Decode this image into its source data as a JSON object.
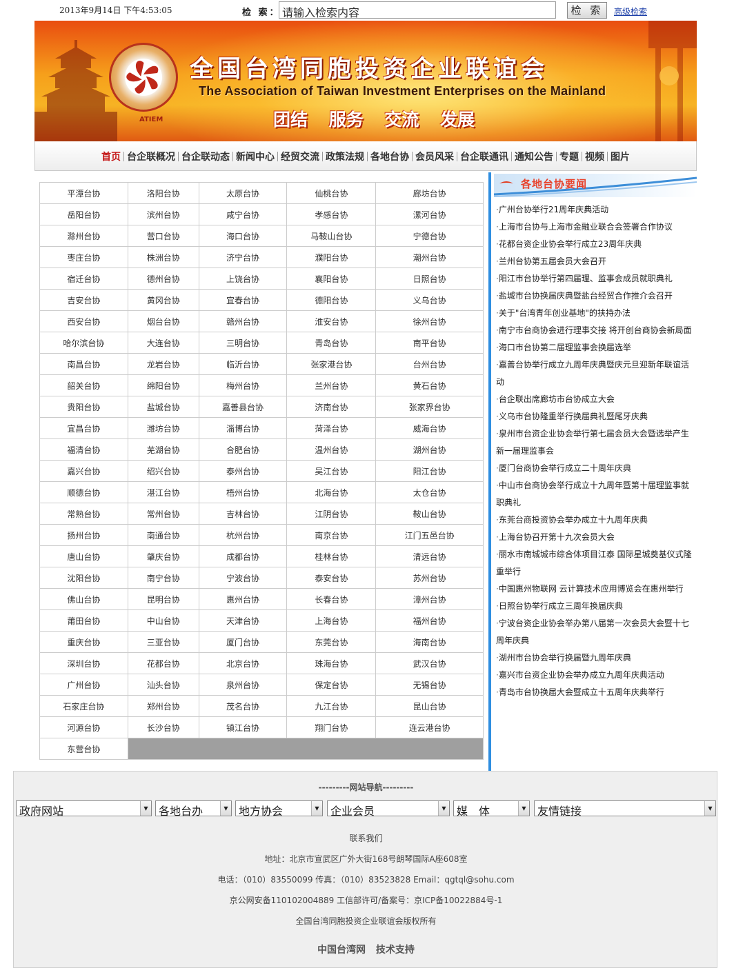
{
  "header": {
    "datetime": "2013年9月14日 下午4:53:05",
    "search_label": "检 索：",
    "search_placeholder": "请输入检索内容",
    "search_button": "检 索",
    "advanced_search": "高级检索"
  },
  "banner": {
    "title_cn": "全国台湾同胞投资企业联谊会",
    "title_en": "The Association of Taiwan Investment Enterprises on the Mainland",
    "slogan": "团结 服务 交流 发展",
    "logo_text": "ATIEM"
  },
  "nav": {
    "items": [
      "首页",
      "台企联概况",
      "台企联动态",
      "新闻中心",
      "经贸交流",
      "政策法规",
      "各地台协",
      "会员风采",
      "台企联通讯",
      "通知公告",
      "专题",
      "视频",
      "图片"
    ]
  },
  "associations": [
    [
      "平潭台协",
      "洛阳台协",
      "太原台协",
      "仙桃台协",
      "廊坊台协"
    ],
    [
      "岳阳台协",
      "滨州台协",
      "咸宁台协",
      "孝感台协",
      "漯河台协"
    ],
    [
      "滁州台协",
      "营口台协",
      "海口台协",
      "马鞍山台协",
      "宁德台协"
    ],
    [
      "枣庄台协",
      "株洲台协",
      "济宁台协",
      "濮阳台协",
      "潮州台协"
    ],
    [
      "宿迁台协",
      "德州台协",
      "上饶台协",
      "襄阳台协",
      "日照台协"
    ],
    [
      "吉安台协",
      "黄冈台协",
      "宜春台协",
      "德阳台协",
      "义乌台协"
    ],
    [
      "西安台协",
      "烟台台协",
      "赣州台协",
      "淮安台协",
      "徐州台协"
    ],
    [
      "哈尔滨台协",
      "大连台协",
      "三明台协",
      "青岛台协",
      "南平台协"
    ],
    [
      "南昌台协",
      "龙岩台协",
      "临沂台协",
      "张家港台协",
      "台州台协"
    ],
    [
      "韶关台协",
      "绵阳台协",
      "梅州台协",
      "兰州台协",
      "黄石台协"
    ],
    [
      "贵阳台协",
      "盐城台协",
      "嘉善县台协",
      "济南台协",
      "张家界台协"
    ],
    [
      "宜昌台协",
      "潍坊台协",
      "淄博台协",
      "菏泽台协",
      "威海台协"
    ],
    [
      "福清台协",
      "芜湖台协",
      "合肥台协",
      "温州台协",
      "湖州台协"
    ],
    [
      "嘉兴台协",
      "绍兴台协",
      "泰州台协",
      "吴江台协",
      "阳江台协"
    ],
    [
      "顺德台协",
      "湛江台协",
      "梧州台协",
      "北海台协",
      "太仓台协"
    ],
    [
      "常熟台协",
      "常州台协",
      "吉林台协",
      "江阴台协",
      "鞍山台协"
    ],
    [
      "扬州台协",
      "南通台协",
      "杭州台协",
      "南京台协",
      "江门五邑台协"
    ],
    [
      "唐山台协",
      "肇庆台协",
      "成都台协",
      "桂林台协",
      "清远台协"
    ],
    [
      "沈阳台协",
      "南宁台协",
      "宁波台协",
      "泰安台协",
      "苏州台协"
    ],
    [
      "佛山台协",
      "昆明台协",
      "惠州台协",
      "长春台协",
      "漳州台协"
    ],
    [
      "莆田台协",
      "中山台协",
      "天津台协",
      "上海台协",
      "福州台协"
    ],
    [
      "重庆台协",
      "三亚台协",
      "厦门台协",
      "东莞台协",
      "海南台协"
    ],
    [
      "深圳台协",
      "花都台协",
      "北京台协",
      "珠海台协",
      "武汉台协"
    ],
    [
      "广州台协",
      "汕头台协",
      "泉州台协",
      "保定台协",
      "无锡台协"
    ],
    [
      "石家庄台协",
      "郑州台协",
      "茂名台协",
      "九江台协",
      "昆山台协"
    ],
    [
      "河源台协",
      "长沙台协",
      "镇江台协",
      "翔门台协",
      "连云港台协"
    ],
    [
      "东营台协"
    ]
  ],
  "news": {
    "title": "各地台协要闻",
    "items": [
      "广州台协举行21周年庆典活动",
      "上海市台协与上海市金融业联合会签署合作协议",
      "花都台资企业协会举行成立23周年庆典",
      "兰州台协第五届会员大会召开",
      "阳江市台协举行第四届理、监事会成员就职典礼",
      "盐城市台协换届庆典暨盐台经贸合作推介会召开",
      "关于\"台湾青年创业基地\"的扶持办法",
      "南宁市台商协会进行理事交接 将开创台商协会新局面",
      "海口市台协第二届理监事会换届选举",
      "嘉善台协举行成立九周年庆典暨庆元旦迎新年联谊活动",
      "台企联出席廊坊市台协成立大会",
      "义乌市台协隆重举行换届典礼暨尾牙庆典",
      "泉州市台资企业协会举行第七届会员大会暨选举产生新一届理监事会",
      "厦门台商协会举行成立二十周年庆典",
      "中山市台商协会举行成立十九周年暨第十届理监事就职典礼",
      "东莞台商投资协会举办成立十九周年庆典",
      "上海台协召开第十九次会员大会",
      "丽水市南城城市综合体项目江泰 国际星城奠基仪式隆重举行",
      "中国惠州物联网 云计算技术应用博览会在惠州举行",
      "日照台协举行成立三周年换届庆典",
      "宁波台资企业协会举办第八届第一次会员大会暨十七周年庆典",
      "湖州市台协会举行换届暨九周年庆典",
      "嘉兴市台资企业协会举办成立九周年庆典活动",
      "青岛市台协换届大会暨成立十五周年庆典举行"
    ]
  },
  "footer": {
    "site_nav_title": "---------网站导航---------",
    "selects": [
      "政府网站",
      "各地台办",
      "地方协会",
      "企业会员",
      "媒　体",
      "友情链接"
    ],
    "contact": "联系我们",
    "address": "地址：北京市宣武区广外大街168号朗琴国际A座608室",
    "phone": "电话：（010）83550099 传真：（010）83523828 Email：qgtql@sohu.com",
    "icp": "京公网安备110102004889 工信部许可/备案号：京ICP备10022884号-1",
    "copyright": "全国台湾同胞投资企业联谊会版权所有",
    "credits": "中国台湾网 技术支持"
  }
}
